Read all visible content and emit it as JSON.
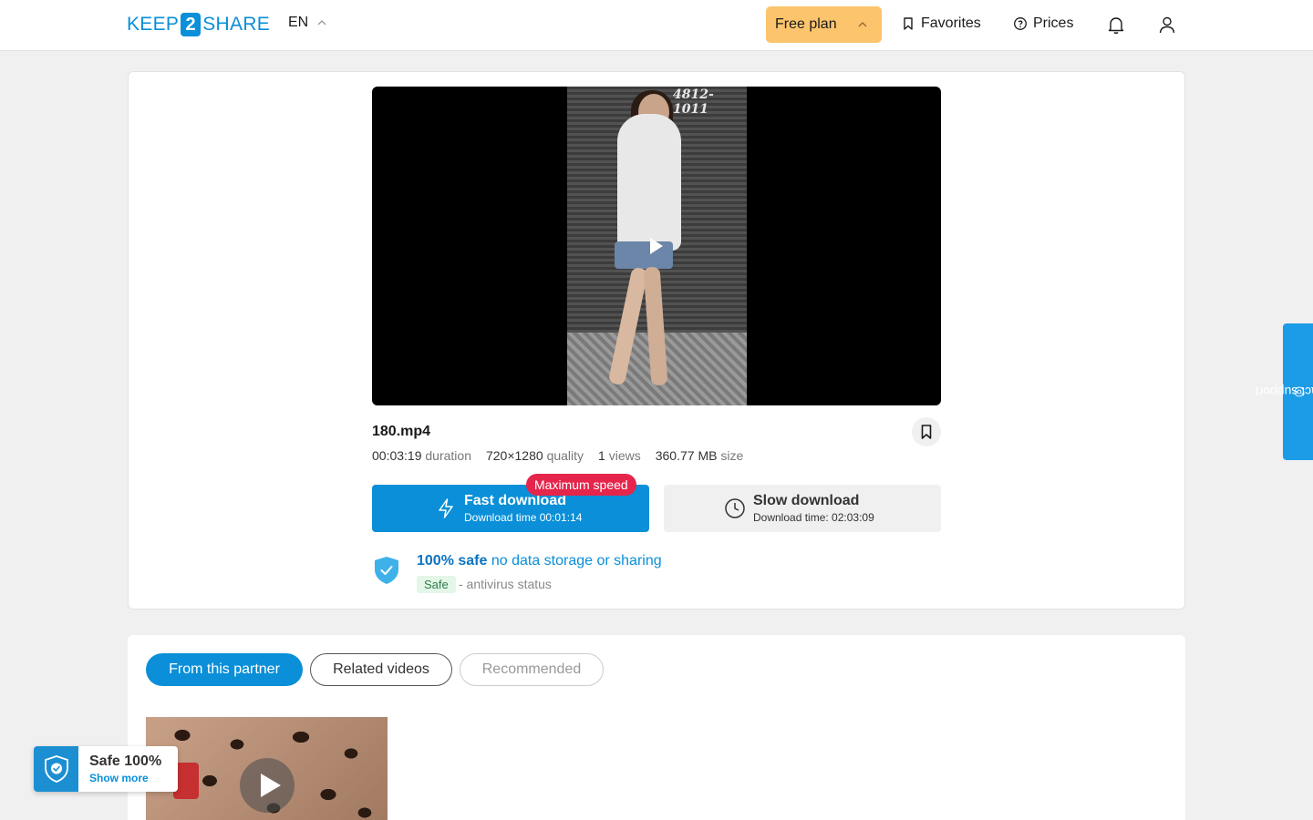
{
  "header": {
    "logo_left": "KEEP",
    "logo_mid": "2",
    "logo_right": "SHARE",
    "language": "EN",
    "plan_label": "Free plan",
    "favorites_label": "Favorites",
    "prices_label": "Prices"
  },
  "video": {
    "frame_sign": "4812-1011"
  },
  "file": {
    "name": "180.mp4",
    "duration_value": "00:03:19",
    "duration_label": "duration",
    "quality_value": "720×1280",
    "quality_label": "quality",
    "views_value": "1",
    "views_label": "views",
    "size_value": "360.77 MB",
    "size_label": "size"
  },
  "downloads": {
    "fast_label": "Fast download",
    "fast_time": "Download time 00:01:14",
    "fast_badge": "Maximum speed",
    "slow_label": "Slow download",
    "slow_time": "Download time: 02:03:09"
  },
  "safety": {
    "headline_bold": "100% safe",
    "headline_rest": "no data storage or sharing",
    "status_tag": "Safe",
    "status_text": "- antivirus status"
  },
  "tabs": [
    {
      "label": "From this partner",
      "active": true
    },
    {
      "label": "Related videos",
      "active": false
    },
    {
      "label": "Recommended",
      "active": false
    }
  ],
  "widget": {
    "title": "Safe 100%",
    "link": "Show more"
  },
  "support": {
    "label": "contact support"
  },
  "colors": {
    "accent": "#0a8fd8",
    "plan": "#fcc46c",
    "badge": "#e5254b",
    "safe_tag_bg": "#e3f6e8"
  }
}
